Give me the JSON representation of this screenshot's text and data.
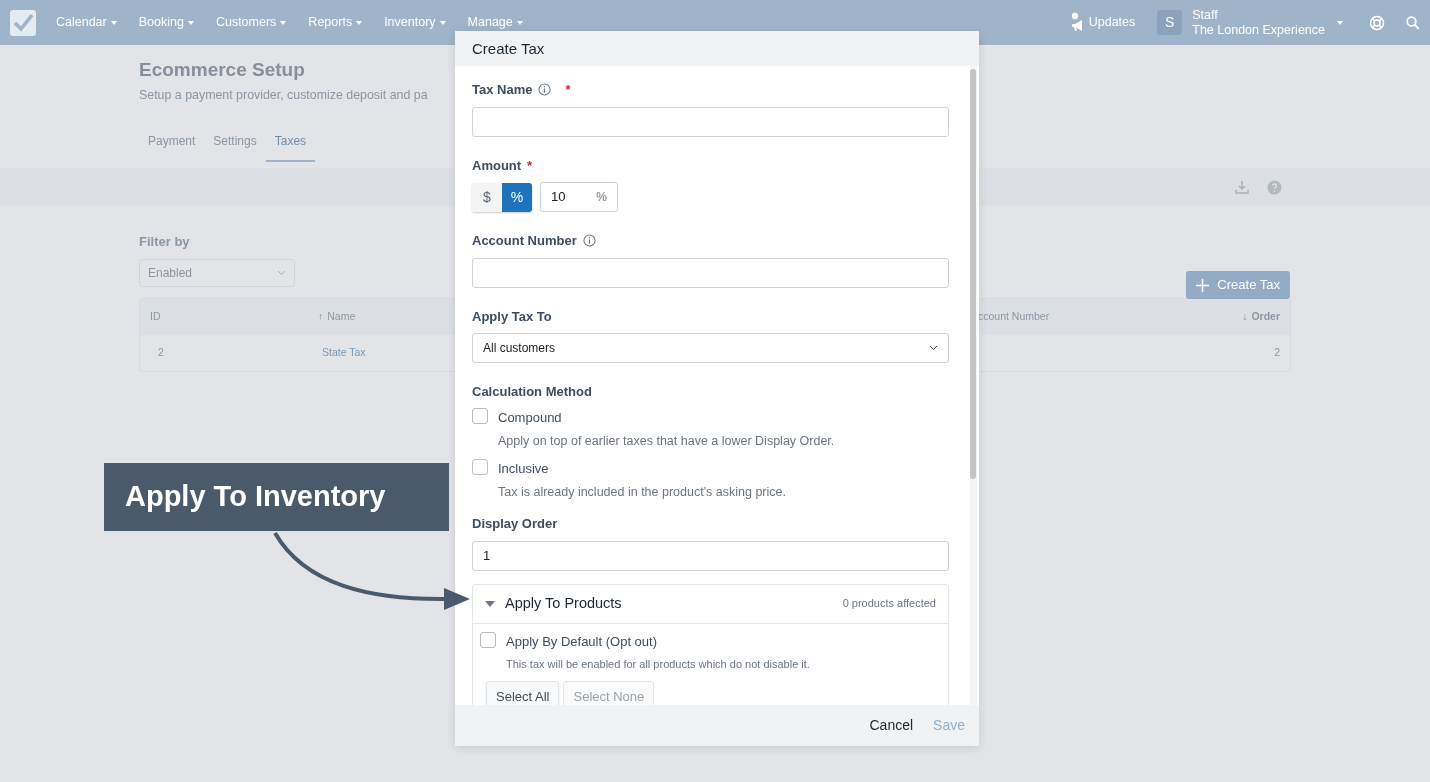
{
  "navbar": {
    "menus": [
      {
        "label": "Calendar"
      },
      {
        "label": "Booking"
      },
      {
        "label": "Customers"
      },
      {
        "label": "Reports"
      },
      {
        "label": "Inventory"
      },
      {
        "label": "Manage"
      }
    ],
    "updates": "Updates",
    "avatar": "S",
    "user": "Staff",
    "org": "The London Experience"
  },
  "page": {
    "title": "Ecommerce Setup",
    "subtitle": "Setup a payment provider, customize deposit and pa",
    "tabs": [
      {
        "label": "Payment",
        "selected": false
      },
      {
        "label": "Settings",
        "selected": false
      },
      {
        "label": "Taxes",
        "selected": true
      }
    ],
    "filter_label": "Filter by",
    "filter_value": "Enabled",
    "create_button": "Create Tax",
    "table": {
      "columns": [
        {
          "label": "ID"
        },
        {
          "label": "Name",
          "sort_arrow": "↑"
        },
        {
          "label": "ccount Number"
        },
        {
          "label": "Order",
          "sort_arrow": "↓"
        }
      ],
      "rows": [
        {
          "cells": [
            "2",
            "State Tax",
            null,
            "2"
          ]
        }
      ]
    }
  },
  "modal": {
    "title": "Create Tax",
    "tax_name": {
      "label": "Tax Name",
      "info": true,
      "required_mark": "*"
    },
    "amount": {
      "label": "Amount",
      "required_mark": "*",
      "modes": [
        {
          "label": "$",
          "selected": false
        },
        {
          "label": "%",
          "selected": true
        }
      ],
      "value": "10",
      "unit": "%"
    },
    "account_number": {
      "label": "Account Number",
      "info": true
    },
    "apply_tax_to": {
      "label": "Apply Tax To",
      "value": "All customers"
    },
    "calculation_method": {
      "label": "Calculation Method",
      "options": [
        {
          "label": "Compound",
          "description": "Apply on top of earlier taxes that have a lower Display Order.",
          "checked": false
        },
        {
          "label": "Inclusive",
          "description": "Tax is already included in the product's asking price.",
          "checked": false
        }
      ]
    },
    "display_order": {
      "label": "Display Order",
      "value": "1"
    },
    "products_panel": {
      "title": "Apply To Products",
      "expanded": true,
      "count": "0 products affected",
      "apply_default": {
        "label": "Apply By Default (Opt out)",
        "description": "This tax will be enabled for all products which do not disable it.",
        "checked": false
      },
      "buttons": [
        {
          "label": "Select All",
          "disabled": false
        },
        {
          "label": "Select None",
          "disabled": true
        }
      ]
    },
    "footer_buttons": [
      {
        "label": "Cancel",
        "disabled": false
      },
      {
        "label": "Save",
        "disabled": true
      }
    ]
  },
  "callout": {
    "text": "Apply To Inventory"
  }
}
